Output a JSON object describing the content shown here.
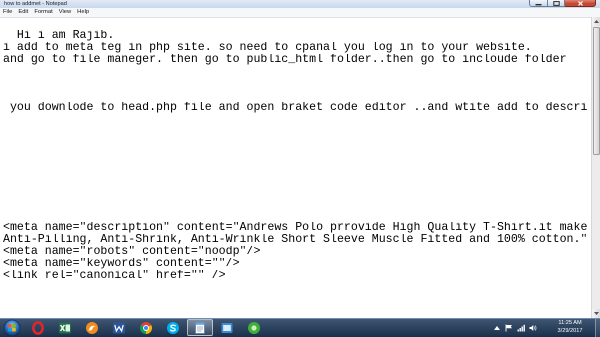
{
  "window": {
    "title": "how to addmet - Notepad",
    "control_icons": [
      "minimize-icon",
      "maximize-icon",
      "close-icon"
    ]
  },
  "menu": {
    "items": [
      "File",
      "Edit",
      "Format",
      "View",
      "Help"
    ]
  },
  "editor": {
    "lines": [
      "",
      "  Hi i am Rajib.",
      "i add to meta teg in php site. so need to cpanal you log in to your website.",
      "and go to file maneger. then go to public_html folder..then go to incloude folder",
      "",
      "",
      "",
      " you downlode to head.php file and open braket code editor ..and wtite add to descri",
      "",
      "",
      "",
      "",
      "",
      "",
      "",
      "",
      "",
      "<meta name=\"description\" content=\"Andrews Polo prrovide High Quality T-Shirt.it make",
      "Anti-Pilling, Anti-Shrink, Anti-Wrinkle Short Sleeve Muscle Fitted and 100% cotton.\"",
      "<meta name=\"robots\" content=\"noodp\"/>",
      "<meta name=\"keywords\" content=\"\"/>",
      "<link rel=\"canonical\" href=\"\" />"
    ]
  },
  "taskbar": {
    "start_icon": "windows-start-orb-icon",
    "apps": [
      {
        "icon": "opera-icon"
      },
      {
        "icon": "excel-icon"
      },
      {
        "icon": "uc-browser-icon"
      },
      {
        "icon": "word-icon"
      },
      {
        "icon": "chrome-icon"
      },
      {
        "icon": "skype-icon"
      },
      {
        "icon": "notepad-icon",
        "active": true
      },
      {
        "icon": "blue-app-icon"
      },
      {
        "icon": "green-app-icon"
      }
    ]
  },
  "tray": {
    "icons": [
      "show-hidden-icons-icon",
      "action-center-flag-icon",
      "network-icon",
      "volume-icon"
    ],
    "time": "11:25 AM",
    "date": "3/29/2017"
  },
  "colors": {
    "titlebar": "#c9d9ee",
    "editor_background": "#ffffff",
    "text": "#000000",
    "close_button": "#c9462f",
    "taskbar": "#1f3a5b"
  }
}
